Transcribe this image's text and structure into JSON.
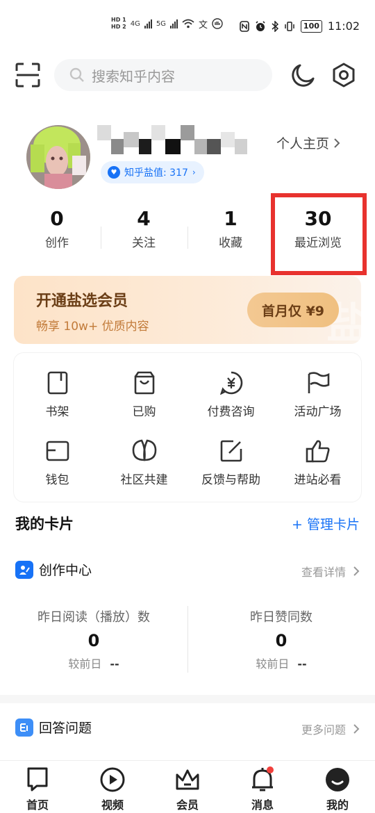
{
  "status_bar": {
    "hd1": "HD 1",
    "hd2": "HD 2",
    "net1": "4G",
    "net2": "5G",
    "battery": "100",
    "time": "11:02"
  },
  "header": {
    "search_placeholder": "搜索知乎内容"
  },
  "profile": {
    "homepage_link": "个人主页",
    "salt_label": "知乎盐值: 317",
    "stats": [
      {
        "value": "0",
        "label": "创作"
      },
      {
        "value": "4",
        "label": "关注"
      },
      {
        "value": "1",
        "label": "收藏"
      },
      {
        "value": "30",
        "label": "最近浏览"
      }
    ]
  },
  "vip": {
    "title": "开通盐选会员",
    "subtitle": "畅享 10w+ 优质内容",
    "button": "首月仅 ¥9"
  },
  "tools": [
    {
      "label": "书架",
      "icon": "bookshelf-icon"
    },
    {
      "label": "已购",
      "icon": "shopping-bag-icon"
    },
    {
      "label": "付费咨询",
      "icon": "yen-chat-icon"
    },
    {
      "label": "活动广场",
      "icon": "flag-icon"
    },
    {
      "label": "钱包",
      "icon": "wallet-icon"
    },
    {
      "label": "社区共建",
      "icon": "leaves-icon"
    },
    {
      "label": "反馈与帮助",
      "icon": "edit-icon"
    },
    {
      "label": "进站必看",
      "icon": "thumbs-up-icon"
    }
  ],
  "cards": {
    "title": "我的卡片",
    "manage": "+ 管理卡片"
  },
  "creation_center": {
    "title": "创作中心",
    "more": "查看详情",
    "metrics": [
      {
        "label": "昨日阅读（播放）数",
        "value": "0",
        "compare_label": "较前日",
        "compare_value": "--"
      },
      {
        "label": "昨日赞同数",
        "value": "0",
        "compare_label": "较前日",
        "compare_value": "--"
      }
    ]
  },
  "answer_section": {
    "title": "回答问题",
    "more": "更多问题"
  },
  "tabbar": [
    {
      "label": "首页",
      "icon": "home-doc-icon"
    },
    {
      "label": "视频",
      "icon": "play-icon"
    },
    {
      "label": "会员",
      "icon": "crown-icon"
    },
    {
      "label": "消息",
      "icon": "bell-icon"
    },
    {
      "label": "我的",
      "icon": "profile-icon"
    }
  ]
}
